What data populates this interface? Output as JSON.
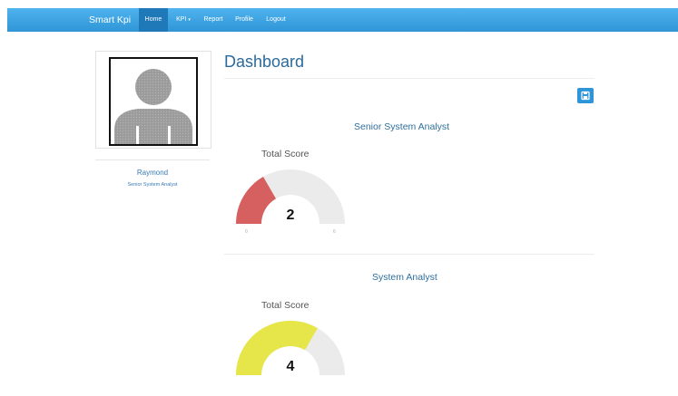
{
  "navbar": {
    "brand": "Smart Kpi",
    "items": [
      {
        "label": "Home",
        "active": true
      },
      {
        "label": "KPI",
        "dropdown": true
      },
      {
        "label": "Report"
      },
      {
        "label": "Profile"
      },
      {
        "label": "Logout"
      }
    ],
    "caret": "▾"
  },
  "profile": {
    "name": "Raymond",
    "title": "Senior System Analyst",
    "avatar_icon": "user-silhouette-icon"
  },
  "main": {
    "title": "Dashboard",
    "save_icon": "floppy-disk-icon",
    "sections": [
      {
        "role": "Senior System Analyst",
        "gauge": {
          "label": "Total Score",
          "value": 2,
          "display": "2",
          "min": 0,
          "max": 6,
          "min_label": "0",
          "max_label": "6",
          "color": "#d66060"
        }
      },
      {
        "role": "System Analyst",
        "gauge": {
          "label": "Total Score",
          "value": 4,
          "display": "4",
          "min": 0,
          "max": 6,
          "color": "#e6e64a"
        }
      }
    ]
  },
  "colors": {
    "navbar": "#3aa3e3",
    "nav_active": "#1f78b8",
    "accent": "#2e95d8",
    "gauge_track": "#ebebeb"
  }
}
